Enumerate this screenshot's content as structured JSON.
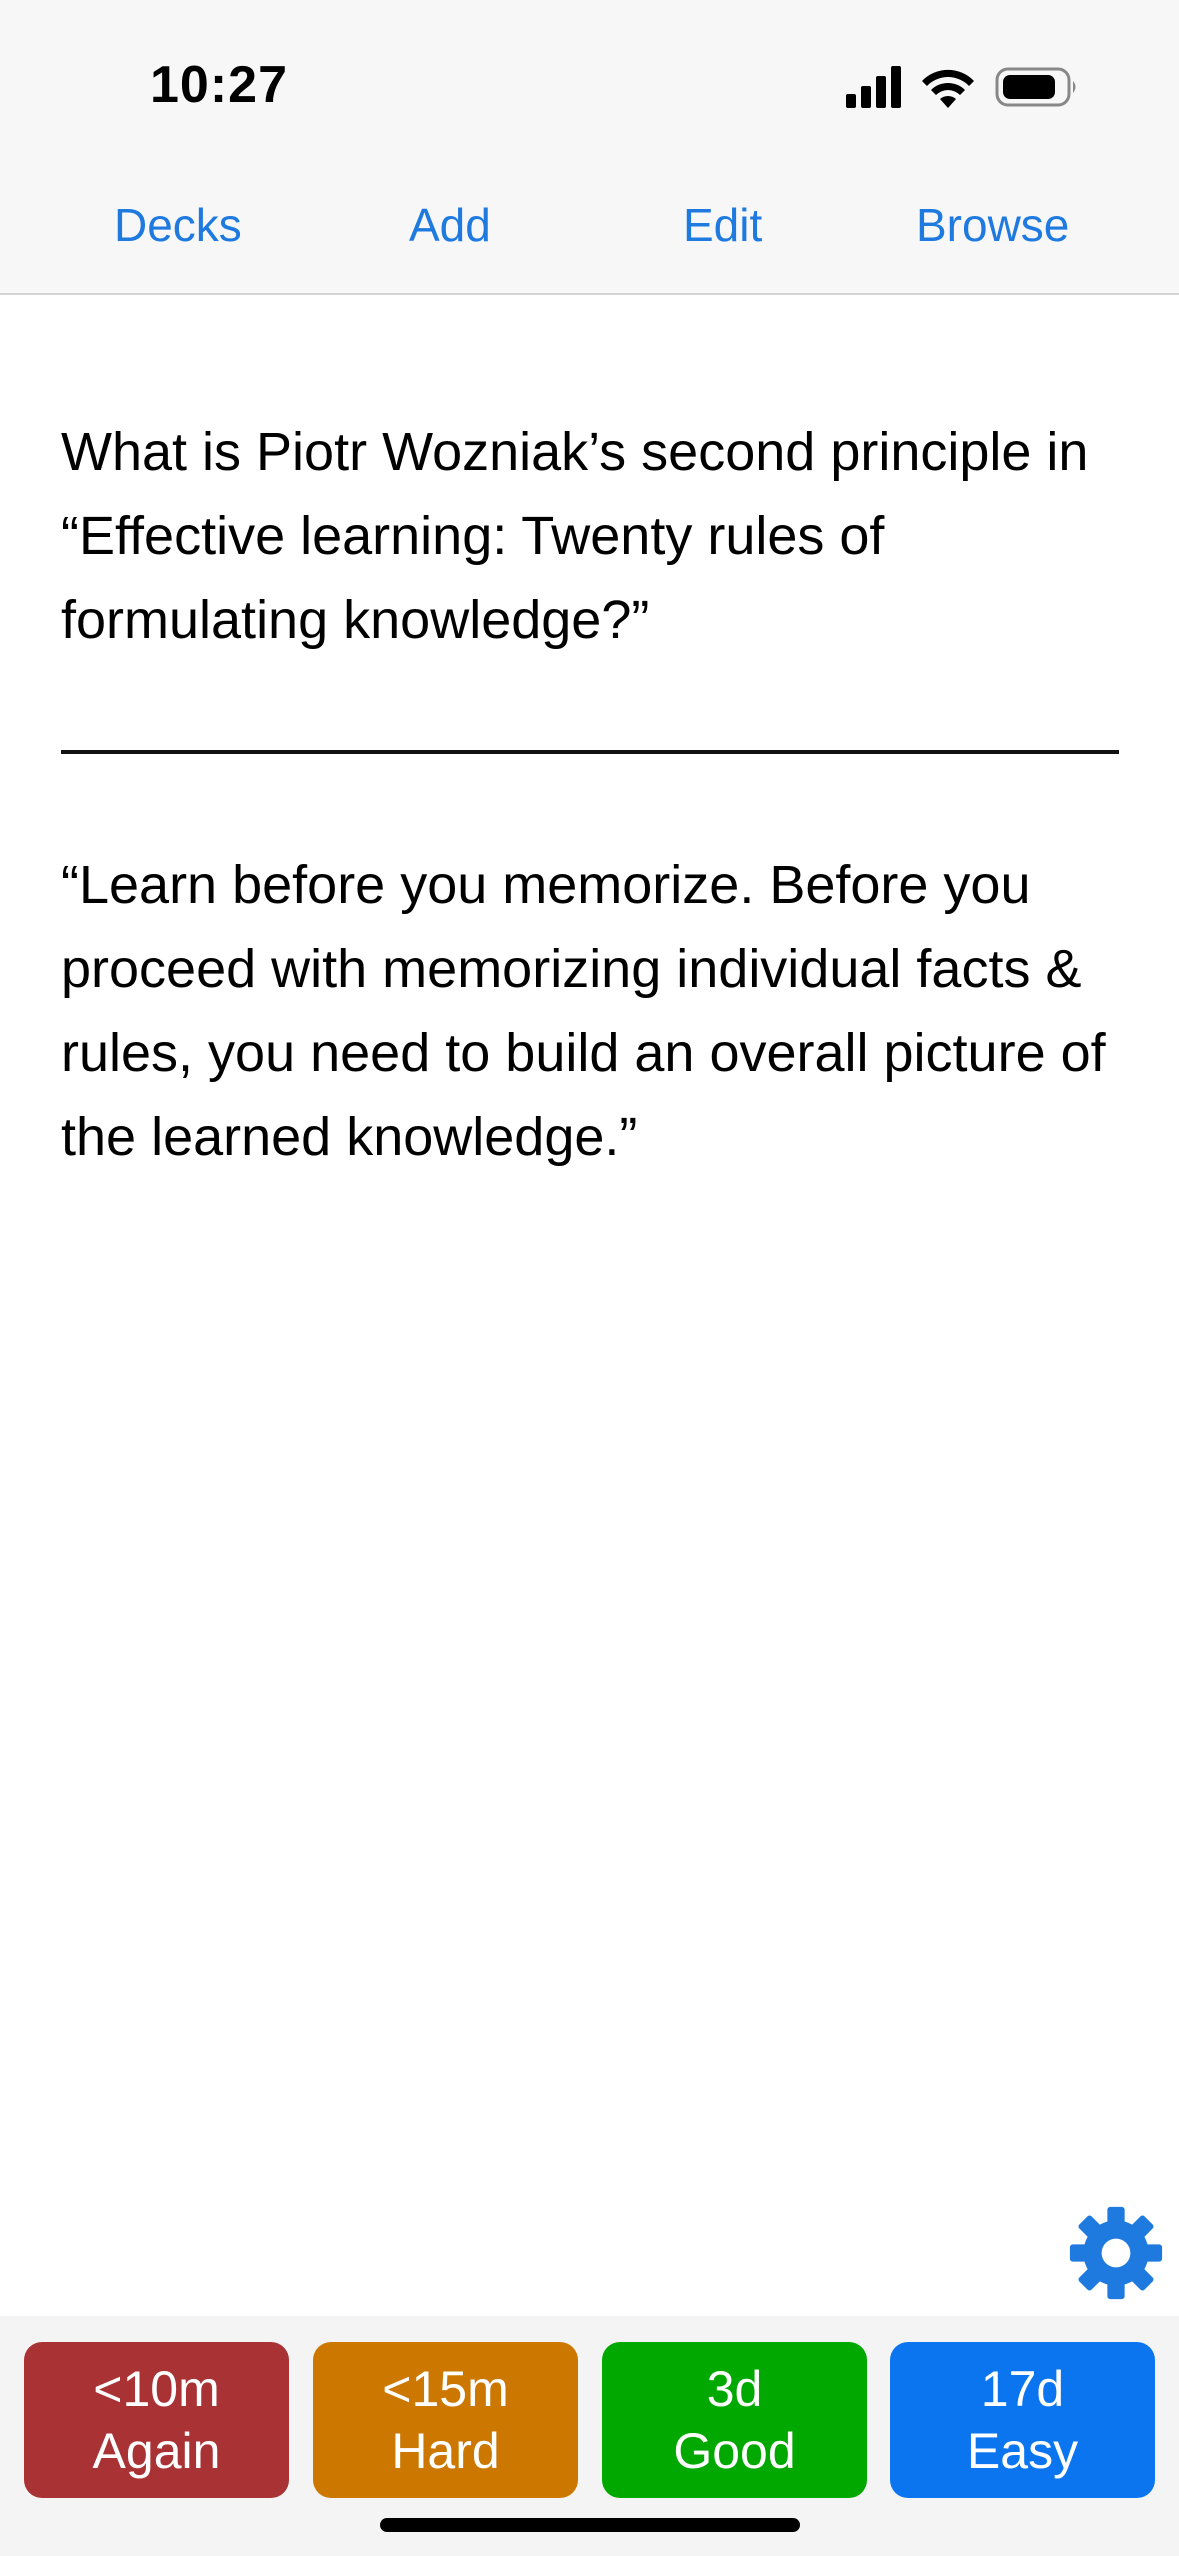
{
  "status_bar": {
    "time": "10:27",
    "icons": [
      "cellular-signal-icon",
      "wifi-icon",
      "battery-icon"
    ]
  },
  "toolbar": {
    "decks_label": "Decks",
    "add_label": "Add",
    "edit_label": "Edit",
    "browse_label": "Browse",
    "link_color": "#1f7ae0"
  },
  "card": {
    "question": "What is Piotr Wozniak’s second principle in “Effective learning: Twenty rules of formulating knowledge?”",
    "answer": "“Learn before you memorize. Before you proceed with memorizing individual facts & rules, you need to build an overall picture of the learned knowledge.”"
  },
  "settings": {
    "icon": "gear-icon",
    "color": "#1f7ae0"
  },
  "answer_buttons": [
    {
      "interval": "<10m",
      "label": "Again",
      "color": "#a83234"
    },
    {
      "interval": "<15m",
      "label": "Hard",
      "color": "#cc7700"
    },
    {
      "interval": "3d",
      "label": "Good",
      "color": "#00a800"
    },
    {
      "interval": "17d",
      "label": "Easy",
      "color": "#0b75f0"
    }
  ]
}
